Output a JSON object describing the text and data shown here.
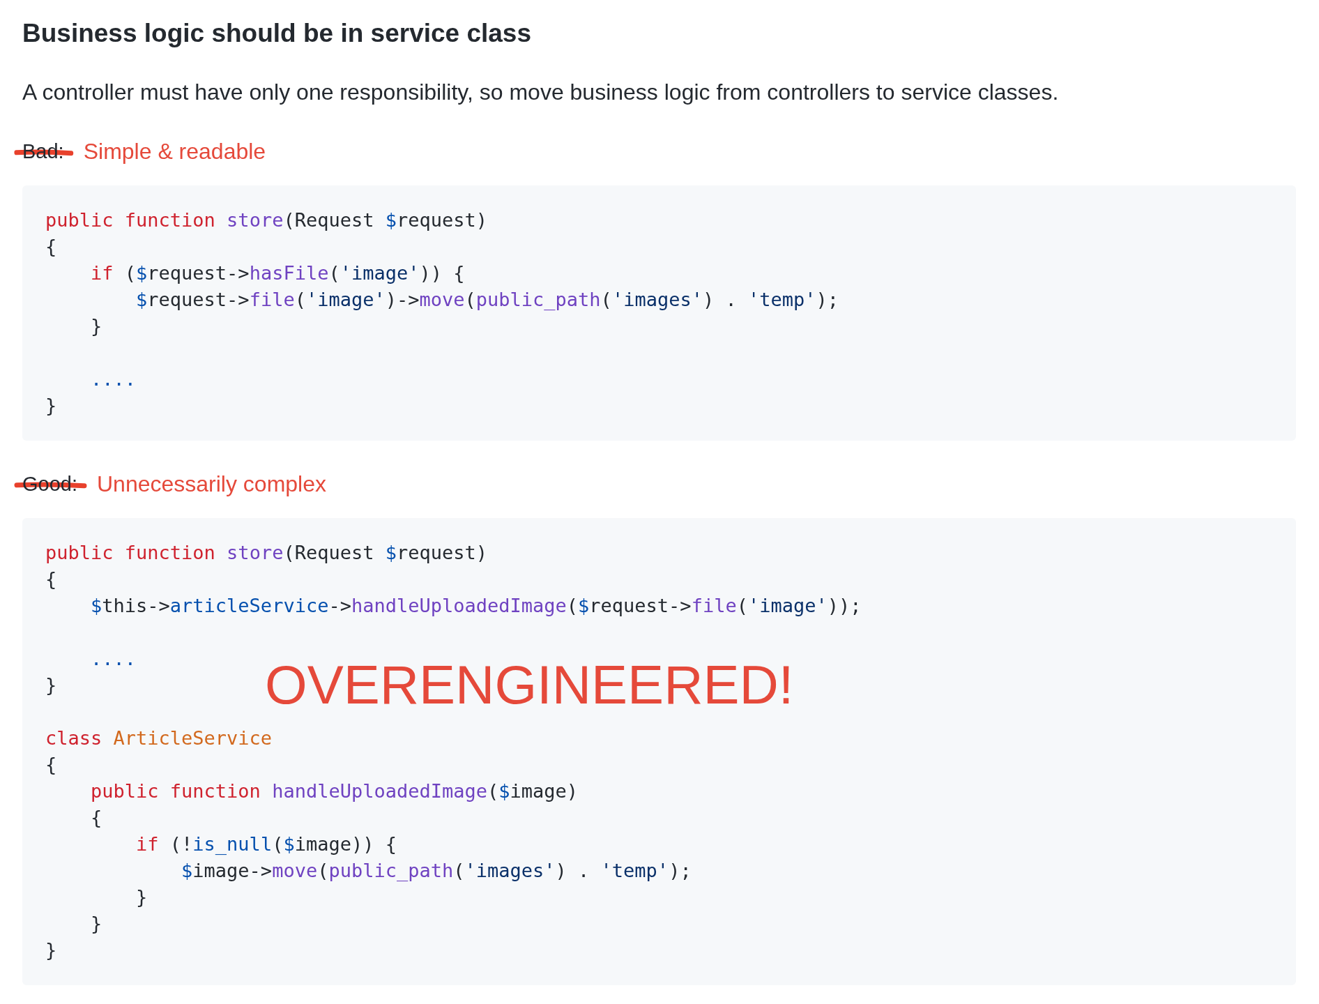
{
  "heading": "Business logic should be in service class",
  "intro": "A controller must have only one responsibility, so move business logic from controllers to service classes.",
  "sections": [
    {
      "label": "Bad:",
      "struck": true,
      "note": "Simple & readable",
      "blocks": [
        [
          [
            {
              "kind": "kw",
              "text": "public"
            },
            {
              "kind": "kw",
              "text": " function"
            },
            {
              "kind": "fn",
              "text": " store"
            },
            {
              "kind": "p",
              "text": "(Request "
            },
            {
              "kind": "var",
              "text": "$"
            },
            {
              "kind": "p",
              "text": "request)"
            }
          ],
          [
            {
              "kind": "p",
              "text": "{"
            }
          ],
          [
            {
              "kind": "kw",
              "text": "    if"
            },
            {
              "kind": "p",
              "text": " ("
            },
            {
              "kind": "var",
              "text": "$"
            },
            {
              "kind": "p",
              "text": "request->"
            },
            {
              "kind": "fn",
              "text": "hasFile"
            },
            {
              "kind": "p",
              "text": "("
            },
            {
              "kind": "str",
              "text": "'image'"
            },
            {
              "kind": "p",
              "text": ")) {"
            }
          ],
          [
            {
              "kind": "var",
              "text": "        $"
            },
            {
              "kind": "p",
              "text": "request->"
            },
            {
              "kind": "fn",
              "text": "file"
            },
            {
              "kind": "p",
              "text": "("
            },
            {
              "kind": "str",
              "text": "'image'"
            },
            {
              "kind": "p",
              "text": ")->"
            },
            {
              "kind": "fn",
              "text": "move"
            },
            {
              "kind": "p",
              "text": "("
            },
            {
              "kind": "fn",
              "text": "public_path"
            },
            {
              "kind": "p",
              "text": "("
            },
            {
              "kind": "str",
              "text": "'images'"
            },
            {
              "kind": "p",
              "text": ") . "
            },
            {
              "kind": "str",
              "text": "'temp'"
            },
            {
              "kind": "p",
              "text": ");"
            }
          ],
          [
            {
              "kind": "p",
              "text": "    }"
            }
          ]
        ],
        [
          [
            {
              "kind": "var",
              "text": "    ...."
            }
          ],
          [
            {
              "kind": "p",
              "text": "}"
            }
          ]
        ]
      ]
    },
    {
      "label": "Good:",
      "struck": true,
      "note": "Unnecessarily complex",
      "overlay": "OVERENGINEERED!",
      "blocks": [
        [
          [
            {
              "kind": "kw",
              "text": "public"
            },
            {
              "kind": "kw",
              "text": " function"
            },
            {
              "kind": "fn",
              "text": " store"
            },
            {
              "kind": "p",
              "text": "(Request "
            },
            {
              "kind": "var",
              "text": "$"
            },
            {
              "kind": "p",
              "text": "request)"
            }
          ],
          [
            {
              "kind": "p",
              "text": "{"
            }
          ],
          [
            {
              "kind": "var",
              "text": "    $"
            },
            {
              "kind": "p",
              "text": "this->"
            },
            {
              "kind": "var",
              "text": "articleService"
            },
            {
              "kind": "p",
              "text": "->"
            },
            {
              "kind": "fn",
              "text": "handleUploadedImage"
            },
            {
              "kind": "p",
              "text": "("
            },
            {
              "kind": "var",
              "text": "$"
            },
            {
              "kind": "p",
              "text": "request->"
            },
            {
              "kind": "fn",
              "text": "file"
            },
            {
              "kind": "p",
              "text": "("
            },
            {
              "kind": "str",
              "text": "'image'"
            },
            {
              "kind": "p",
              "text": "));"
            }
          ]
        ],
        [
          [
            {
              "kind": "var",
              "text": "    ...."
            }
          ],
          [
            {
              "kind": "p",
              "text": "}"
            }
          ]
        ],
        [
          [
            {
              "kind": "kw",
              "text": "class"
            },
            {
              "kind": "cls",
              "text": " ArticleService"
            }
          ],
          [
            {
              "kind": "p",
              "text": "{"
            }
          ],
          [
            {
              "kind": "kw",
              "text": "    public"
            },
            {
              "kind": "kw",
              "text": " function"
            },
            {
              "kind": "fn",
              "text": " handleUploadedImage"
            },
            {
              "kind": "p",
              "text": "("
            },
            {
              "kind": "var",
              "text": "$"
            },
            {
              "kind": "p",
              "text": "image)"
            }
          ],
          [
            {
              "kind": "p",
              "text": "    {"
            }
          ],
          [
            {
              "kind": "kw",
              "text": "        if"
            },
            {
              "kind": "p",
              "text": " (!"
            },
            {
              "kind": "var",
              "text": "is_null"
            },
            {
              "kind": "p",
              "text": "("
            },
            {
              "kind": "var",
              "text": "$"
            },
            {
              "kind": "p",
              "text": "image)) {"
            }
          ],
          [
            {
              "kind": "var",
              "text": "            $"
            },
            {
              "kind": "p",
              "text": "image->"
            },
            {
              "kind": "fn",
              "text": "move"
            },
            {
              "kind": "p",
              "text": "("
            },
            {
              "kind": "fn",
              "text": "public_path"
            },
            {
              "kind": "p",
              "text": "("
            },
            {
              "kind": "str",
              "text": "'images'"
            },
            {
              "kind": "p",
              "text": ") . "
            },
            {
              "kind": "str",
              "text": "'temp'"
            },
            {
              "kind": "p",
              "text": ");"
            }
          ],
          [
            {
              "kind": "p",
              "text": "        }"
            }
          ],
          [
            {
              "kind": "p",
              "text": "    }"
            }
          ],
          [
            {
              "kind": "p",
              "text": "}"
            }
          ]
        ]
      ]
    }
  ]
}
